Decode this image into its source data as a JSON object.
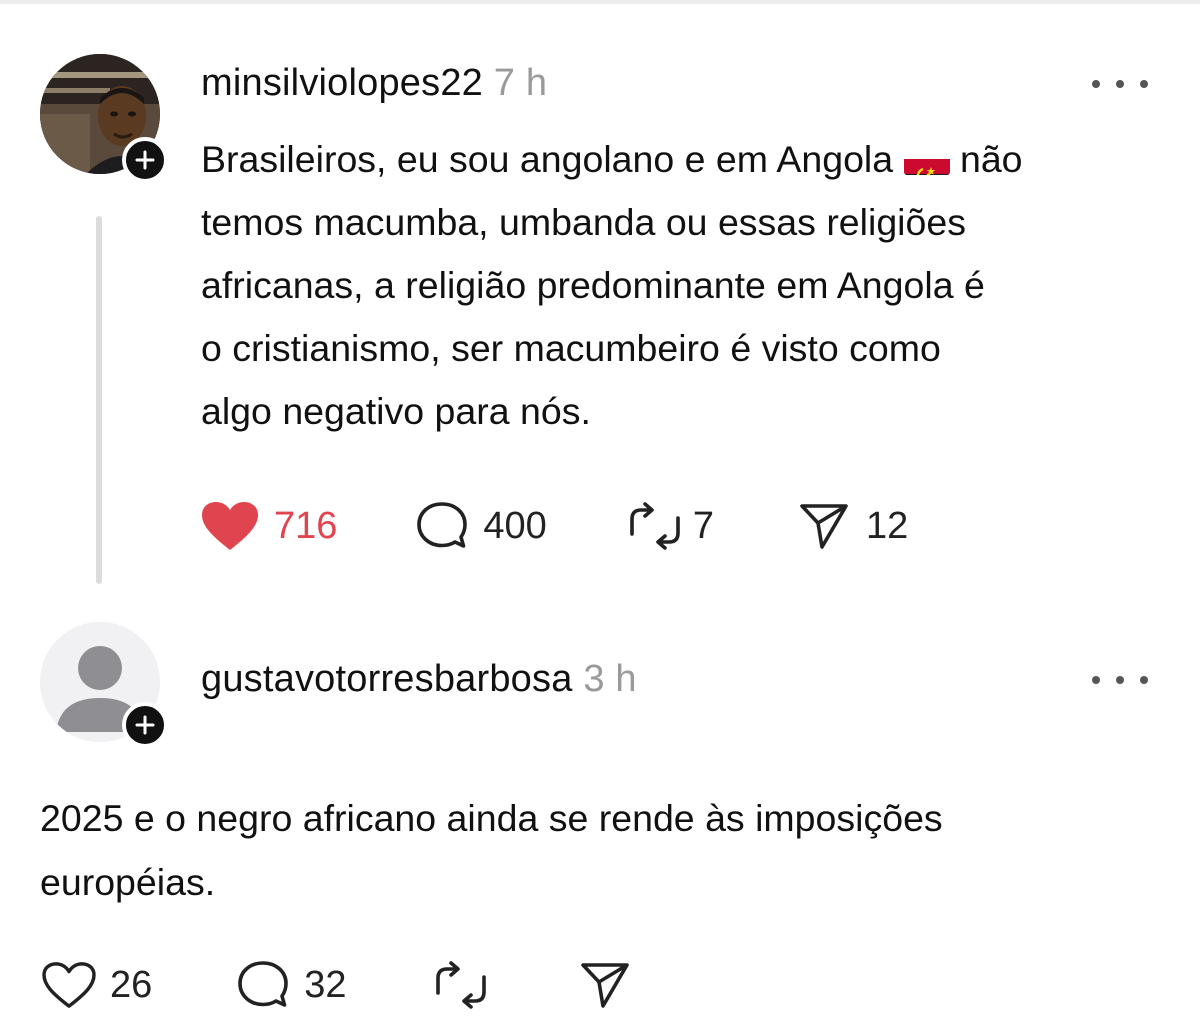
{
  "posts": [
    {
      "username": "minsilviolopes22",
      "time": "7 h",
      "text_lines": [
        "Brasileiros, eu sou angolano e em Angola",
        "temos macumba, umbanda ou essas religiões",
        "africanas, a religião predominante em Angola é",
        "o cristianismo, ser macumbeiro é visto como",
        "algo negativo para nós."
      ],
      "text_after_flag": "não",
      "flag_icon": "angola-flag",
      "likes": "716",
      "liked": true,
      "replies": "400",
      "reposts": "7",
      "shares": "12"
    },
    {
      "username": "gustavotorresbarbosa",
      "time": "3 h",
      "text_lines": [
        "2025 e o negro africano ainda se rende às imposições",
        "européias."
      ],
      "likes": "26",
      "liked": false,
      "replies": "32"
    }
  ],
  "icons": {
    "like": "heart-icon",
    "reply": "comment-icon",
    "repost": "repost-icon",
    "share": "send-icon",
    "more": "more-icon",
    "follow": "plus-icon"
  },
  "colors": {
    "like_active": "#e0454f",
    "muted_text": "#9a9a9a",
    "thread_line": "#dcdcdc"
  }
}
